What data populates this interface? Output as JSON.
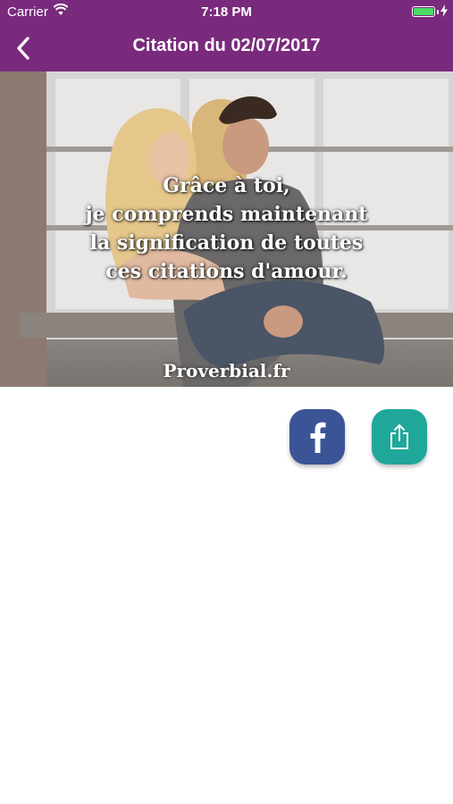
{
  "status_bar": {
    "carrier": "Carrier",
    "time": "7:18 PM"
  },
  "nav": {
    "title": "Citation du 02/07/2017"
  },
  "quote": {
    "lines": [
      "Grâce à toi,",
      "je comprends maintenant",
      "la signification de toutes",
      "ces citations d'amour."
    ],
    "watermark": "Proverbial.fr"
  },
  "actions": {
    "facebook_icon": "facebook-icon",
    "share_icon": "share-icon"
  },
  "colors": {
    "header": "#7a2a7c",
    "facebook": "#3b5496",
    "share": "#1fa89a",
    "battery": "#4cd964"
  }
}
